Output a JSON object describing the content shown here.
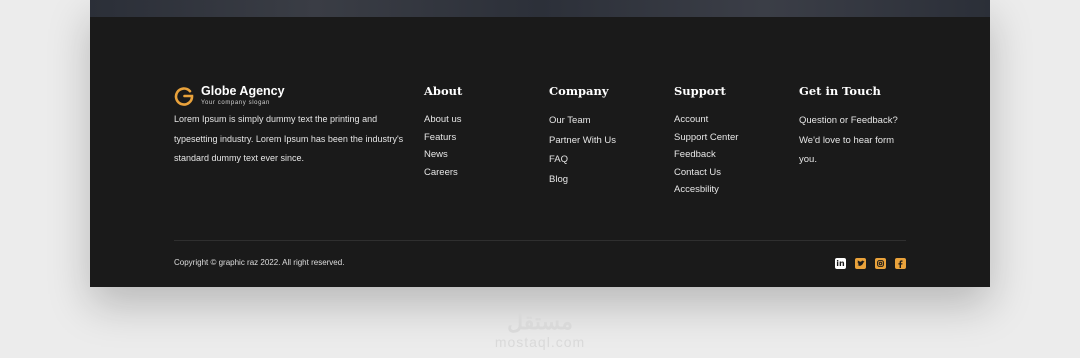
{
  "brand": {
    "name": "Globe Agency",
    "slogan": "Your company slogan",
    "description": "Lorem Ipsum is simply dummy text  the printing and typesetting industry. Lorem Ipsum has been the industry's standard dummy text ever since.",
    "accent_color": "#e9a23b"
  },
  "columns": {
    "about": {
      "title": "About",
      "items": [
        "About us",
        "Featurs",
        "News",
        "Careers"
      ]
    },
    "company": {
      "title": "Company",
      "items": [
        "Our Team",
        "Partner With Us",
        "FAQ",
        "Blog"
      ]
    },
    "support": {
      "title": "Support",
      "items": [
        "Account",
        "Support Center",
        "Feedback",
        "Contact Us",
        "Accesbility"
      ]
    },
    "contact": {
      "title": "Get in Touch",
      "text": "Question or Feedback? We'd love to hear form you."
    }
  },
  "footer": {
    "copyright": "Copyright © graphic raz 2022. All right reserved.",
    "social": [
      "linkedin-icon",
      "twitter-icon",
      "instagram-icon",
      "facebook-icon"
    ]
  },
  "watermark": {
    "arabic": "مستقل",
    "latin": "mostaql.com"
  }
}
